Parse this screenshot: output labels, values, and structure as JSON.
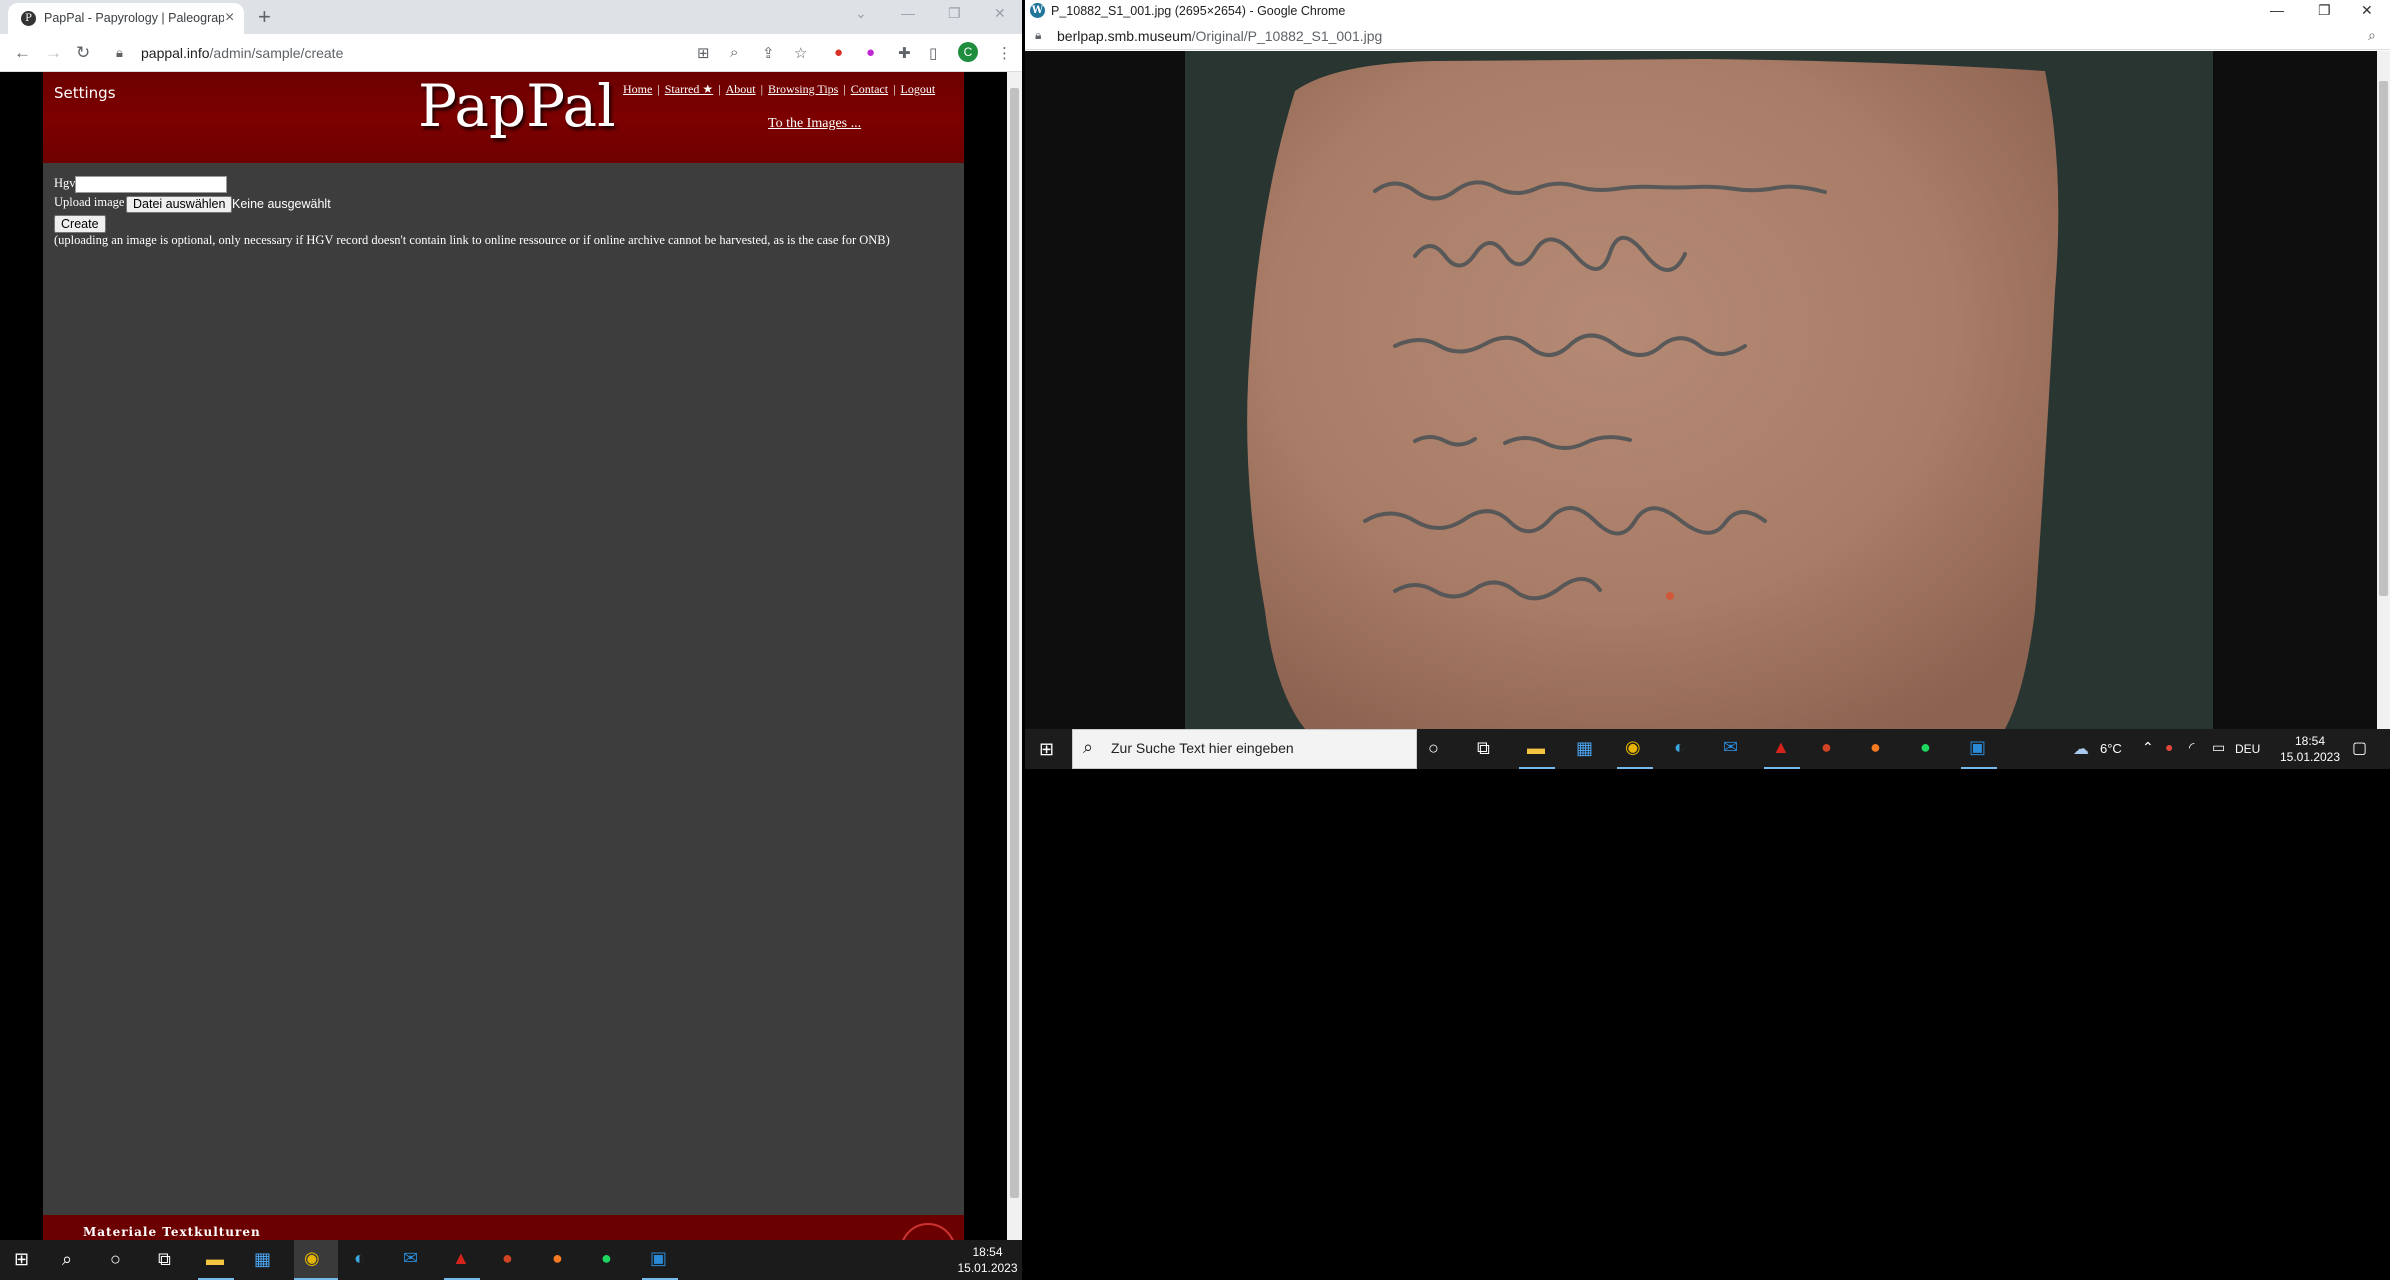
{
  "left_window": {
    "tab_title": "PapPal - Papyrology | Paleography",
    "url_host": "pappal.info",
    "url_path": "/admin/sample/create",
    "profile_initial": "C"
  },
  "page": {
    "settings": "Settings",
    "logo": "PapPal",
    "nav": [
      "Home",
      "Starred ★",
      "About",
      "Browsing Tips",
      "Contact",
      "Logout"
    ],
    "to_images": "To the Images ...",
    "hgv_label": "Hgv",
    "upload_label": "Upload image",
    "file_button": "Datei auswählen",
    "no_file": "Keine ausgewählt",
    "create_button": "Create",
    "note": "(uploading an image is optional, only necessary if HGV record doesn't contain link to online ressource or if online archive cannot be harvested, as is the case for ONB)",
    "footer": "Materiale Textkulturen"
  },
  "right_window": {
    "title": "P_10882_S1_001.jpg (2695×2654) - Google Chrome",
    "url_host": "berlpap.smb.museum",
    "url_path": "/Original/P_10882_S1_001.jpg"
  },
  "taskbar_main": {
    "time": "18:54",
    "date": "15.01.2023"
  },
  "taskbar_secondary": {
    "search_placeholder": "Zur Suche Text hier eingeben",
    "weather": "6°C",
    "lang": "DEU",
    "time": "18:54",
    "date": "15.01.2023"
  },
  "colors": {
    "header_red": "#7d0000",
    "content_grey": "#3d3d3d",
    "taskbar": "#1b1b1b"
  }
}
